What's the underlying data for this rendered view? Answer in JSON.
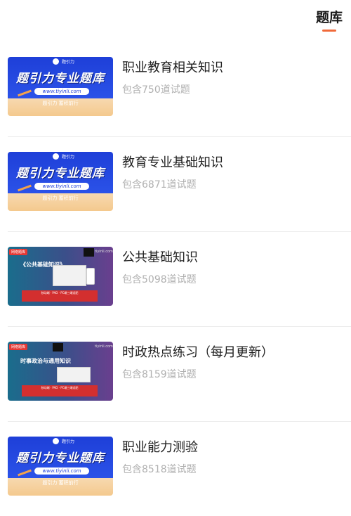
{
  "header": {
    "tab_label": "题库"
  },
  "items": [
    {
      "title": "职业教育相关知识",
      "subtitle": "包含750道试题",
      "thumb": {
        "kind": "blue",
        "logo_text": "题引力",
        "banner_title": "题引力专业题库",
        "url": "www.tiyinli.com",
        "slogan": "题引力 蓄积前行"
      }
    },
    {
      "title": "教育专业基础知识",
      "subtitle": "包含6871道试题",
      "thumb": {
        "kind": "blue",
        "logo_text": "题引力",
        "banner_title": "题引力专业题库",
        "url": "www.tiyinli.com",
        "slogan": "题引力 蓄积前行"
      }
    },
    {
      "title": "公共基础知识",
      "subtitle": "包含5098道试题",
      "thumb": {
        "kind": "course",
        "tag": "网络题库",
        "logo_text": "题引力",
        "url": "tiyinli.com",
        "course_title": "《公共基础知识》",
        "footer": "移动端 · PAD · PC端三端适配"
      }
    },
    {
      "title": "时政热点练习（每月更新）",
      "subtitle": "包含8159道试题",
      "thumb": {
        "kind": "course",
        "tag": "网络题库",
        "logo_text": "题引力",
        "url": "tiyinli.com",
        "course_title": "时事政治与通用知识",
        "footer": "移动端 · PAD · PC端三端适配"
      }
    },
    {
      "title": "职业能力测验",
      "subtitle": "包含8518道试题",
      "thumb": {
        "kind": "blue",
        "logo_text": "题引力",
        "banner_title": "题引力专业题库",
        "url": "www.tiyinli.com",
        "slogan": "题引力 蓄积前行"
      }
    }
  ],
  "colors": {
    "accent": "#f06a3a",
    "title_text": "#222222",
    "subtitle_text": "#b0b0b0",
    "banner_blue": "#1e3fd8"
  }
}
